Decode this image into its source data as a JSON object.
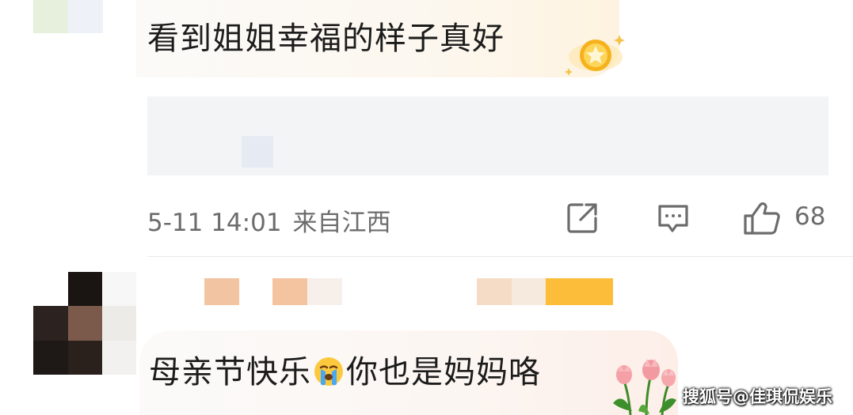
{
  "comment_1": {
    "text": "看到姐姐幸福的样子真好",
    "time": "5-11 14:01",
    "location": "来自江西",
    "likes": "68",
    "badge_icon": "star-badge-icon"
  },
  "actions": {
    "share_icon": "share-icon",
    "comment_icon": "comment-icon",
    "like_icon": "thumbs-up-icon"
  },
  "comment_2": {
    "text_before": "母亲节快乐",
    "emoji": "crying-face-emoji",
    "text_after": "你也是妈妈咯",
    "sticker": "tulips-sticker"
  },
  "watermark": "搜狐号@佳琪侃娱乐",
  "colors": {
    "meta_text": "#6c6c6c",
    "badge_gold": "#f6b21c",
    "mosaic_orange": "#fbbd3a"
  }
}
